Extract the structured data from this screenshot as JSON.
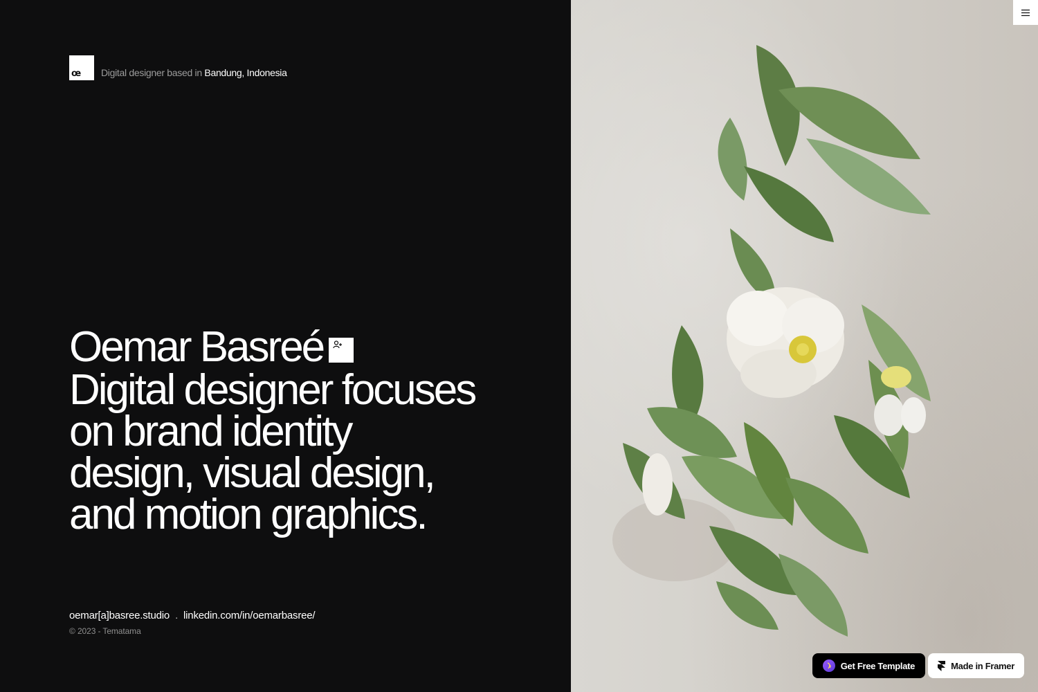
{
  "header": {
    "logo_text": "œ",
    "tagline_prefix": "Digital designer based in",
    "tagline_location": "Bandung, Indonesia"
  },
  "hero": {
    "name": "Oemar Basreé",
    "description": "Digital designer focuses on brand identity design, visual design, and motion graphics."
  },
  "contact": {
    "email": "oemar[a]basree.studio",
    "separator": ".",
    "linkedin": "linkedin.com/in/oemarbasree/"
  },
  "footer": {
    "copyright": "© 2023 - Tematama"
  },
  "badges": {
    "template_label": "Get Free Template",
    "framer_label": "Made in Framer"
  },
  "icons": {
    "user_badge": "user-plus-icon",
    "menu": "hamburger-menu-icon",
    "framer": "framer-logo-icon"
  },
  "colors": {
    "background": "#0e0e0f",
    "text": "#ffffff",
    "muted_text": "#9c9c9c",
    "template_badge_bg": "#000000",
    "template_badge_accent": "#9a5cff",
    "framer_badge_bg": "#ffffff"
  }
}
